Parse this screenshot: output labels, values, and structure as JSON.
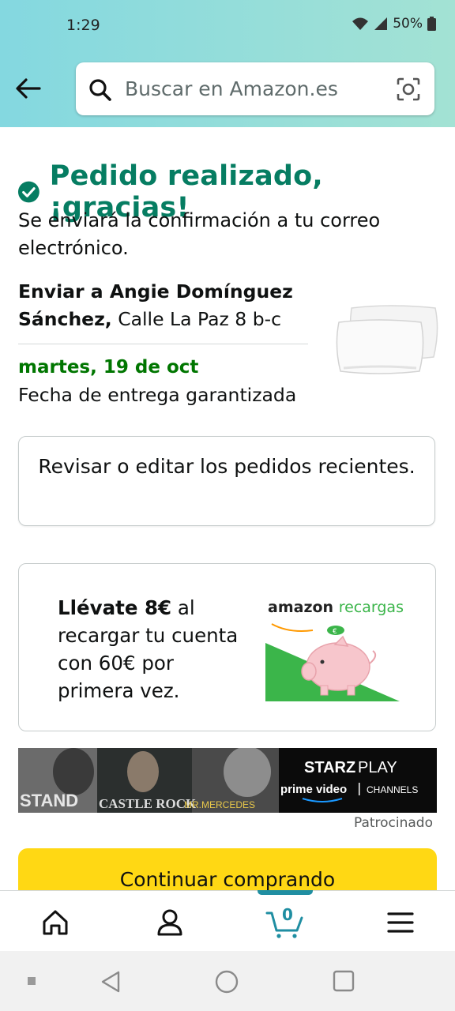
{
  "status_bar": {
    "time": "1:29",
    "battery": "50%"
  },
  "search": {
    "placeholder": "Buscar en Amazon.es"
  },
  "order": {
    "title": "Pedido realizado, ¡gracias!",
    "confirmation": "Se enviará la confirmación a tu correo electrónico.",
    "ship_to_label": "Enviar a Angie Domínguez Sánchez,",
    "ship_to_address": "Calle La Paz 8 b-c",
    "delivery_date": "martes, 19 de oct",
    "delivery_note": "Fecha de entrega garantizada"
  },
  "review_button": {
    "label": "Revisar o editar los pedidos recientes."
  },
  "promo": {
    "bold": "Llévate 8€",
    "text": " al recargar tu cuenta con 60€ por primera vez.",
    "logo_amazon": "amazon",
    "logo_recargas": "recargas"
  },
  "banner": {
    "t1": "STAND",
    "t2": "CASTLE ROCK",
    "t3": "MR.MERCEDES",
    "brand1": "STARZ",
    "brand2": "PLAY",
    "brand3": "prime video",
    "brand4": "CHANNELS"
  },
  "sponsored": "Patrocinado",
  "continue_button": {
    "label": "Continuar comprando"
  },
  "bottom_nav": {
    "cart_count": "0"
  },
  "colors": {
    "success_green": "#067d62",
    "date_green": "#007600",
    "button_yellow": "#ffd814",
    "nav_accent": "#1f8ea2"
  }
}
